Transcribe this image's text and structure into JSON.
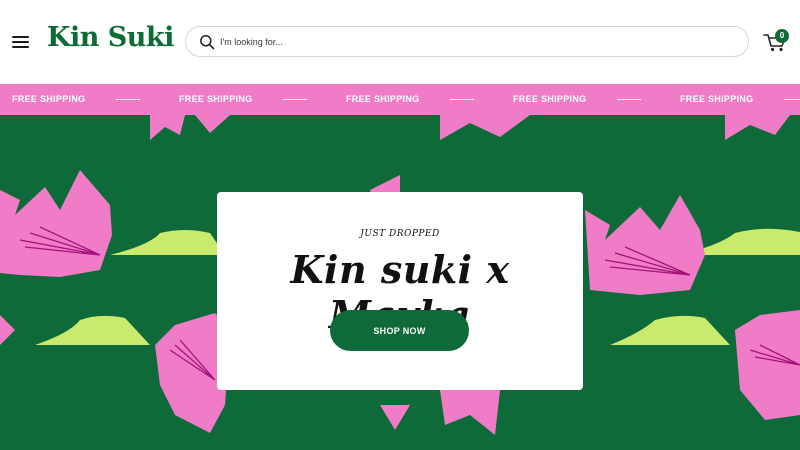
{
  "brand": {
    "name": "Kin Suki",
    "color": "#0f6b34"
  },
  "header": {
    "menu_icon": "hamburger-menu-icon",
    "search": {
      "placeholder": "I'm looking for...",
      "value": "",
      "icon": "search-icon"
    },
    "cart": {
      "icon": "cart-icon",
      "count": "0"
    }
  },
  "marquee": {
    "background": "#f07cc8",
    "items": [
      "FREE SHIPPING",
      "FREE SHIPPING",
      "FREE SHIPPING",
      "FREE SHIPPING",
      "FREE SHIPPING"
    ]
  },
  "hero": {
    "background": "#0e6b39",
    "accent_pink": "#f07cc8",
    "accent_lime": "#c9ea6c",
    "eyebrow": "JUST DROPPED",
    "headline": "Kin suki x Mayka",
    "cta_label": "SHOP NOW"
  }
}
